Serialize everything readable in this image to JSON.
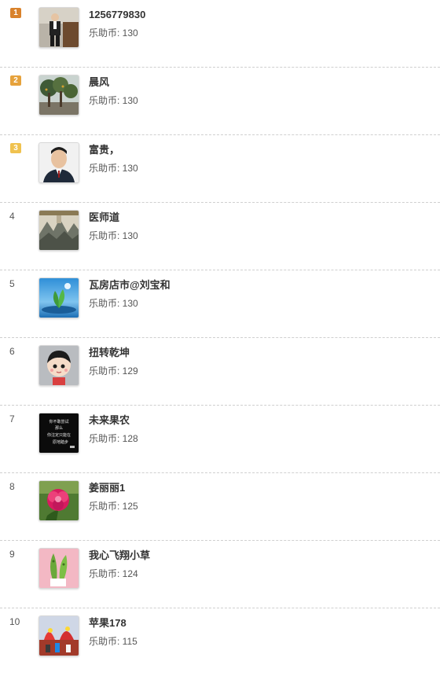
{
  "coin_label": "乐助币: ",
  "ranking": [
    {
      "rank": "1",
      "name": "1256779830",
      "coins": "130",
      "badge_color": "#d9822b",
      "avatar_icon": "man-in-suit-photo-icon"
    },
    {
      "rank": "2",
      "name": "晨风",
      "coins": "130",
      "badge_color": "#e6a23c",
      "avatar_icon": "trees-photo-icon"
    },
    {
      "rank": "3",
      "name": "富贵，",
      "coins": "130",
      "badge_color": "#f0c24f",
      "avatar_icon": "portrait-photo-icon"
    },
    {
      "rank": "4",
      "name": "医师道",
      "coins": "130",
      "avatar_icon": "mountain-scroll-icon"
    },
    {
      "rank": "5",
      "name": "瓦房店市@刘宝和",
      "coins": "130",
      "avatar_icon": "leaf-on-water-icon"
    },
    {
      "rank": "6",
      "name": "扭转乾坤",
      "coins": "129",
      "avatar_icon": "cartoon-girl-icon"
    },
    {
      "rank": "7",
      "name": "未来果农",
      "coins": "128",
      "avatar_icon": "text-on-black-icon",
      "avatar_text": [
        "你不敢尝试",
        "那么",
        "你注定只能在",
        "原地踏步"
      ]
    },
    {
      "rank": "8",
      "name": "姜丽丽1",
      "coins": "125",
      "avatar_icon": "pink-flower-icon"
    },
    {
      "rank": "9",
      "name": "我心飞翔小草",
      "coins": "124",
      "avatar_icon": "green-plant-icon"
    },
    {
      "rank": "10",
      "name": "苹果178",
      "coins": "115",
      "avatar_icon": "festival-scene-icon"
    }
  ]
}
